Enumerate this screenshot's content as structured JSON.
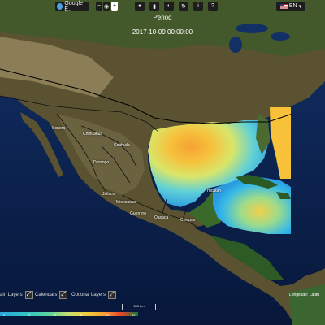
{
  "toolbar": {
    "basemap_selected": "Google E..",
    "language": "EN"
  },
  "period": {
    "title": "Period",
    "datetime": "2017-10-09 00:00:00"
  },
  "cities": [
    "Sonora",
    "Chihuahua",
    "Coahuila",
    "Durango",
    "Jalisco",
    "Michoacan",
    "Guerrero",
    "Oaxaca",
    "Chiapas",
    "Yucatan"
  ],
  "bottom_controls": {
    "main_layers": "ain Layers",
    "calendars": "Calendars",
    "optional_layers": "Optional Layers"
  },
  "scale_label": "500 km",
  "coordinate_readout": "Longitude:  Latitu",
  "legend": {
    "ticks": [
      "2",
      "4",
      "6",
      "8",
      "10",
      "12"
    ],
    "colors": [
      "#2da4d9",
      "#2ec4c4",
      "#58d4a0",
      "#c7e06a",
      "#f0d040",
      "#f5a233",
      "#e8422b",
      "#0d7a33"
    ]
  }
}
